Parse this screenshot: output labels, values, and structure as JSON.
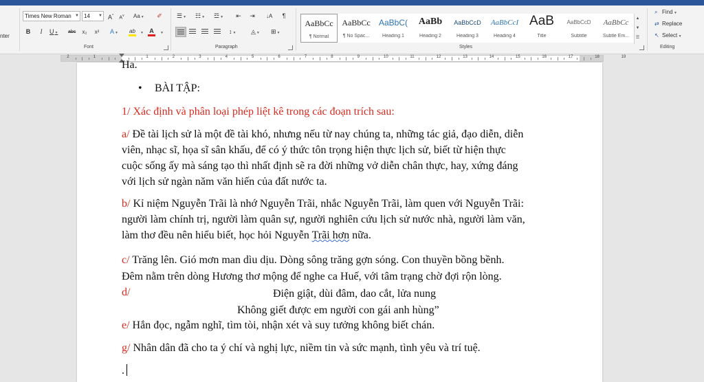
{
  "ribbon": {
    "clipped_label": "nter",
    "font": {
      "group_label": "Font",
      "font_name": "Times New Roman",
      "font_size": "14",
      "grow": "A",
      "shrink": "A",
      "change_case": "Aa",
      "bold": "B",
      "italic": "I",
      "underline": "U",
      "strike": "abc",
      "subscript": "x₂",
      "superscript": "x²",
      "text_effects": "A",
      "highlight": "ab",
      "font_color": "A"
    },
    "paragraph": {
      "group_label": "Paragraph",
      "sort_icon": "↓A"
    },
    "styles": {
      "group_label": "Styles",
      "items": [
        {
          "sample": "AaBbCc",
          "name": "¶ Normal"
        },
        {
          "sample": "AaBbCc",
          "name": "¶ No Spac..."
        },
        {
          "sample": "AaBbC(",
          "name": "Heading 1"
        },
        {
          "sample": "AaBb",
          "name": "Heading 2"
        },
        {
          "sample": "AaBbCcD",
          "name": "Heading 3"
        },
        {
          "sample": "AaBbCcI",
          "name": "Heading 4"
        },
        {
          "sample": "AaB",
          "name": "Title"
        },
        {
          "sample": "AaBbCcD",
          "name": "Subtitle"
        },
        {
          "sample": "AaBbCc",
          "name": "Subtle Em..."
        }
      ]
    },
    "editing": {
      "group_label": "Editing",
      "find": "Find",
      "replace": "Replace",
      "select": "Select"
    }
  },
  "ruler": {
    "numbers": [
      "2",
      "1",
      "1",
      "2",
      "3",
      "4",
      "5",
      "6",
      "7",
      "8",
      "9",
      "10",
      "11",
      "12",
      "13",
      "14",
      "15",
      "16",
      "17",
      "18",
      "19"
    ]
  },
  "document": {
    "clipped_top": "Ha.",
    "bullet_char": "•",
    "heading": "BÀI TẬP:",
    "task": "1/ Xác định và phân loại phép liệt kê trong các đoạn trích sau:",
    "a": {
      "marker": "a/",
      "lines": [
        "Đề tài lịch sử là một đề tài khó, nhưng nếu từ nay chúng ta, những tác giả, đạo diễn, diễn",
        "viên, nhạc sĩ, họa sĩ sân khấu, để có ý thức tôn trọng hiện thực lịch sử, biết từ hiện thực",
        "cuộc sống ấy mà sáng tạo thì nhất định sẽ ra đời những vở diễn chân thực, hay, xứng đáng",
        "với lịch sử ngàn năm văn hiến của đất nước ta."
      ]
    },
    "b": {
      "marker": "b/",
      "line1": "Kỉ niệm Nguyễn Trãi là nhớ Nguyễn Trãi, nhắc Nguyễn Trãi, làm quen với Nguyễn Trãi:",
      "line2": "người làm chính trị, người làm quân sự, người nghiên cứu lịch sử nước nhà, người làm văn,",
      "line3_before": "làm thơ đều nên hiểu biết, học hỏi Nguyễn ",
      "line3_squiggle": "Trãi  hơn",
      "line3_after": " nữa."
    },
    "c": {
      "marker": "c/",
      "line1": "Trăng lên. Gió mơn man dìu dịu. Dòng sông trăng gợn sóng. Con thuyền bồng bềnh.",
      "line2": "Đêm nằm trên dòng Hương thơ mộng để nghe ca Huế, với tâm trạng chờ đợi rộn lòng."
    },
    "d": {
      "marker": "d/",
      "line1": "Điện giật, dùi đâm, dao cắt, lửa nung",
      "line2": "Không giết được em người con gái anh hùng”"
    },
    "e": {
      "marker": "e/",
      "text": "Hắn đọc, ngẫm nghĩ, tìm tòi, nhận xét và suy tưởng không biết chán."
    },
    "g": {
      "marker": "g/",
      "text": "Nhân dân đã cho ta ý chí và nghị lực, niềm tin và sức mạnh, tình yêu và trí tuệ."
    },
    "last_line": "."
  },
  "colors": {
    "accent": "#2b579a",
    "red_text": "#d62b1e"
  }
}
